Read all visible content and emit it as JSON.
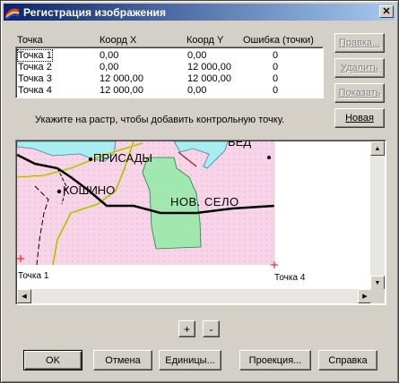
{
  "window": {
    "title": "Регистрация изображения",
    "close_label": "✕"
  },
  "table": {
    "headers": [
      "Точка",
      "Коорд X",
      "Коорд Y",
      "Ошибка (точки)"
    ],
    "rows": [
      {
        "name": "Точка 1",
        "x": "0,00",
        "y": "0,00",
        "err": "0"
      },
      {
        "name": "Точка 2",
        "x": "0,00",
        "y": "12 000,00",
        "err": "0"
      },
      {
        "name": "Точка 3",
        "x": "12 000,00",
        "y": "12 000,00",
        "err": "0"
      },
      {
        "name": "Точка 4",
        "x": "12 000,00",
        "y": "0,00",
        "err": "0"
      }
    ]
  },
  "side_buttons": {
    "edit": "Правка...",
    "delete": "Удалить",
    "show": "Показать",
    "new": "Новая"
  },
  "hint": "Укажите на растр, чтобы добавить контрольную точку.",
  "map": {
    "labels": {
      "prisady": "ПРИСАДЫ",
      "koshino": "КОШИНО",
      "nov_selo": "НОВ. СЕЛО",
      "top_partial": "ВЕД"
    },
    "point_labels": {
      "p1": "Точка 1",
      "p4": "Точка 4"
    }
  },
  "zoom": {
    "plus": "+",
    "minus": "-"
  },
  "buttons": {
    "ok": "OK",
    "cancel": "Отмена",
    "units": "Единицы...",
    "projection": "Проекция...",
    "help": "Справка"
  },
  "colors": {
    "title_start": "#0a246a",
    "title_end": "#a6caf0",
    "map_bg": "#f8d4e8",
    "water": "#a8eef0",
    "forest": "#a0e8b0",
    "road": "#e0e070",
    "point_marker": "#ff0000"
  }
}
